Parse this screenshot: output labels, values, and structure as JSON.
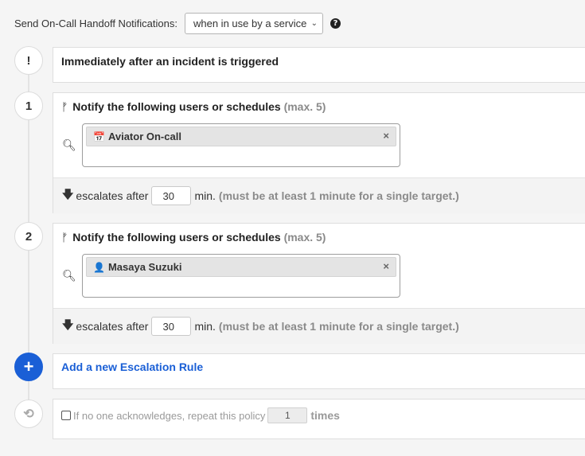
{
  "handoff": {
    "label": "Send On-Call Handoff Notifications:",
    "selected": "when in use by a service",
    "help_glyph": "?"
  },
  "trigger": {
    "marker": "!",
    "title": "Immediately after an incident is triggered"
  },
  "rules": [
    {
      "number": "1",
      "route_glyph": "ᚠ",
      "heading": "Notify the following users or schedules",
      "max_note": "(max. 5)",
      "target": {
        "icon": "calendar-icon",
        "glyph": "📅",
        "name": "Aviator On-call",
        "remove": "×"
      },
      "escalate_label": "escalates after",
      "minutes": "30",
      "min_label": "min.",
      "note": "(must be at least 1 minute for a single target.)"
    },
    {
      "number": "2",
      "route_glyph": "ᚠ",
      "heading": "Notify the following users or schedules",
      "max_note": "(max. 5)",
      "target": {
        "icon": "user-icon",
        "glyph": "👤",
        "name": "Masaya Suzuki",
        "remove": "×"
      },
      "escalate_label": "escalates after",
      "minutes": "30",
      "min_label": "min.",
      "note": "(must be at least 1 minute for a single target.)"
    }
  ],
  "add_rule": {
    "marker": "+",
    "label": "Add a new Escalation Rule"
  },
  "repeat": {
    "marker": "⟲",
    "label": "If no one acknowledges, repeat this policy",
    "count": "1",
    "times": "times"
  },
  "colors": {
    "accent": "#1a5fd6",
    "muted": "#8a8a8a",
    "background": "#f5f5f5"
  }
}
